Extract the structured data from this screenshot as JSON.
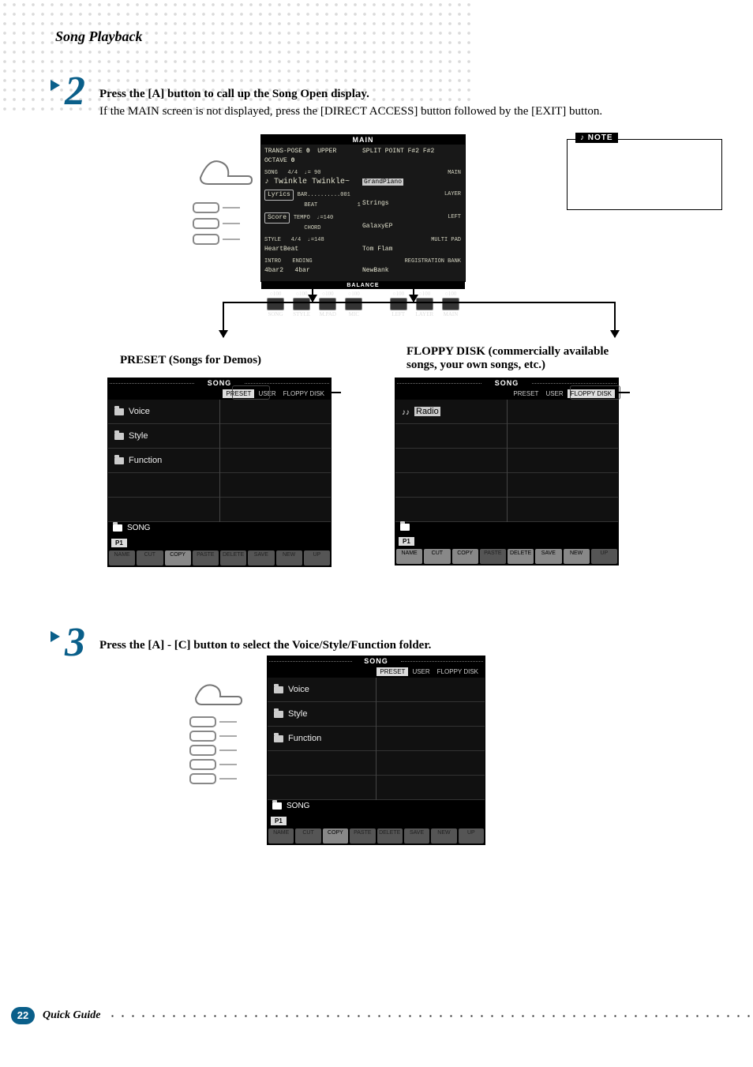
{
  "section_title": "Song Playback",
  "step2": {
    "number": "2",
    "bold_line": "Press the [A] button to call up the Song Open display.",
    "sub_line": "If the MAIN screen is not displayed, press the [DIRECT ACCESS] button followed by the [EXIT] button."
  },
  "step3": {
    "number": "3",
    "bold_line": "Press the [A] - [C] button to select the Voice/Style/Function folder."
  },
  "main_lcd": {
    "title": "MAIN",
    "transpose_label": "TRANS-POSE",
    "transpose_val": "0",
    "octave_label": "UPPER OCTAVE",
    "octave_val": "0",
    "split_label": "SPLIT POINT",
    "split_val": "F#2",
    "split_val2": "F#2",
    "song_label": "SONG",
    "time_sig": "4/4",
    "tempo_marker": "♩= 90",
    "song_name": "♪ Twinkle Twinkle~",
    "main_label": "MAIN",
    "grand": "GrandPiano",
    "lyrics_btn": "Lyrics",
    "bar_label": "BAR",
    "bar_val": "001",
    "beat_label": "BEAT",
    "beat_val": "1",
    "layer_label": "LAYER",
    "strings": "Strings",
    "score_btn": "Score",
    "tempo2_label": "TEMPO",
    "tempo2_val": "♩=140",
    "chord_label": "CHORD",
    "left_label": "LEFT",
    "galaxy": "GalaxyEP",
    "style_label": "STYLE",
    "style_time": "4/4",
    "style_tempo": "♩=148",
    "style_name": "HeartBeat",
    "multipad_label": "MULTI PAD",
    "multipad_name": "Tom Flam",
    "intro_label": "INTRO",
    "intro_val": "4bar2",
    "ending_label": "ENDING",
    "ending_val": "4bar",
    "regbank_label": "REGISTRATION BANK",
    "regbank_name": "NewBank",
    "balance_label": "BALANCE",
    "balance_cols": [
      "SONG",
      "STYLE",
      "M.PAD",
      "MIC",
      "",
      "LEFT",
      "LAYER",
      "MAIN"
    ],
    "balance_vals": [
      "100",
      "100",
      "100",
      "100",
      "",
      "100",
      "100",
      "100"
    ]
  },
  "note_box_label": "NOTE",
  "caption_preset": "PRESET (Songs for Demos)",
  "caption_floppy_title": "FLOPPY DISK (commercially available",
  "caption_floppy_sub": "songs, your own songs, etc.)",
  "preset_panel": {
    "head": "SONG",
    "tabs": [
      "PRESET",
      "USER",
      "FLOPPY DISK"
    ],
    "active_tab": 0,
    "rows": [
      "Voice",
      "Style",
      "Function"
    ],
    "status": "SONG",
    "page_tab": "P1",
    "bottom": [
      "NAME",
      "CUT",
      "COPY",
      "PASTE",
      "DELETE",
      "SAVE",
      "NEW",
      "UP"
    ]
  },
  "floppy_panel": {
    "head": "SONG",
    "tabs": [
      "PRESET",
      "USER",
      "FLOPPY DISK"
    ],
    "active_tab": 2,
    "rows": [
      "Radio"
    ],
    "status": "",
    "page_tab": "P1",
    "bottom": [
      "NAME",
      "CUT",
      "COPY",
      "PASTE",
      "DELETE",
      "SAVE",
      "NEW",
      "UP"
    ]
  },
  "step3_panel": {
    "head": "SONG",
    "tabs": [
      "PRESET",
      "USER",
      "FLOPPY DISK"
    ],
    "active_tab": 0,
    "rows": [
      "Voice",
      "Style",
      "Function"
    ],
    "status": "SONG",
    "page_tab": "P1",
    "bottom": [
      "NAME",
      "CUT",
      "COPY",
      "PASTE",
      "DELETE",
      "SAVE",
      "NEW",
      "UP"
    ]
  },
  "footer": {
    "page": "22",
    "title": "Quick Guide"
  }
}
